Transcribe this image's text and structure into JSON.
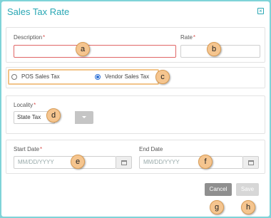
{
  "dialog": {
    "title": "Sales Tax Rate"
  },
  "fields": {
    "description_label": "Description",
    "rate_label": "Rate",
    "required_mark": "*",
    "locality_label": "Locality",
    "start_date_label": "Start Date",
    "end_date_label": "End Date",
    "date_placeholder": "MM/DD/YYYY"
  },
  "tax_type": {
    "options": [
      "POS Sales Tax",
      "Vendor Sales Tax"
    ],
    "selected": "Vendor Sales Tax"
  },
  "locality": {
    "selected": "State Tax"
  },
  "buttons": {
    "cancel": "Cancel",
    "save": "Save",
    "close": "×"
  },
  "callouts": [
    "a",
    "b",
    "c",
    "d",
    "e",
    "f",
    "g",
    "h"
  ],
  "colors": {
    "title": "#29a7b4",
    "callout": "#f5c58f",
    "error_border": "#e06666",
    "radio_selected": "#2a6fd6"
  },
  "icons": [
    "close-icon",
    "chevron-down-icon",
    "calendar-icon"
  ]
}
